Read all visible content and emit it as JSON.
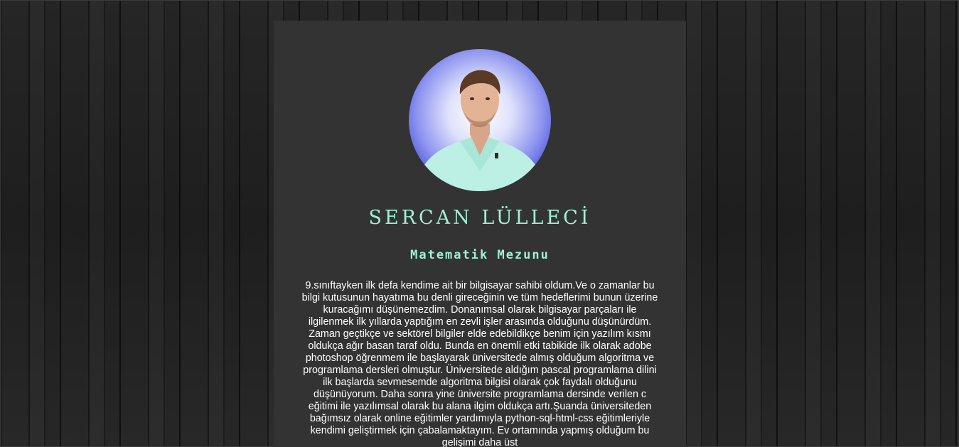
{
  "profile": {
    "name": "SERCAN LÜLLECİ",
    "title": "Matematik Mezunu",
    "bio": "9.sınıftayken ilk defa kendime ait bir bilgisayar sahibi oldum.Ve o zamanlar bu bilgi kutusunun hayatıma bu denli gireceğinin ve tüm hedeflerimi bunun üzerine kuracağımı düşünemezdim. Donanımsal olarak bilgisayar parçaları ile ilgilenmek ilk yıllarda yaptığım en zevli işler arasında olduğunu düşünürdüm. Zaman geçtikçe ve sektörel bilgiler elde edebildikçe benim için yazılım kısmı oldukça ağır basan taraf oldu. Bunda en önemli etki tabikide ilk olarak adobe photoshop öğrenmem ile başlayarak üniversitede almış olduğum algoritma ve programlama dersleri olmuştur. Üniversitede aldığım pascal programlama dilini ilk başlarda sevmesemde algoritma bilgisi olarak çok faydalı olduğunu düşünüyorum. Daha sonra yine üniversite programlama dersinde verilen c eğitimi ile yazılımsal olarak bu alana ilgim oldukça artı.Şuanda üniversiteden bağımsız olarak online eğitimler yardımıyla python-sql-html-css eğitimleriyle kendimi geliştirmek için çabalamaktayım. Ev ortamında yapmış olduğum bu gelişimi daha üst"
  },
  "colors": {
    "accent": "#9ef0d6",
    "card_background": "#333333",
    "page_background": "#1d1d1d",
    "avatar_ring": "#2426c4"
  }
}
